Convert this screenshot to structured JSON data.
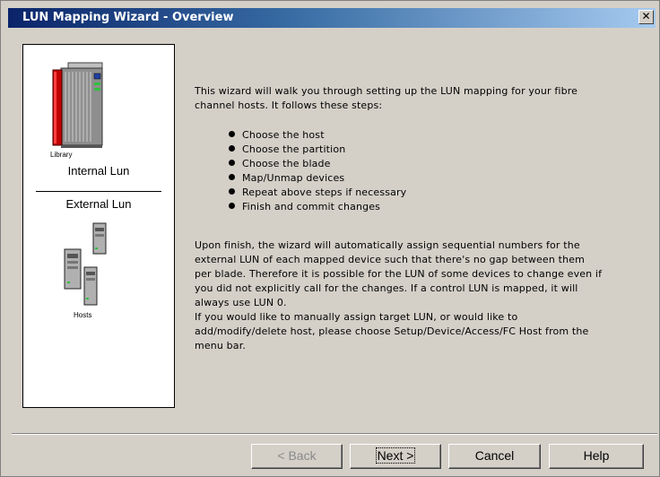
{
  "window": {
    "title": "LUN Mapping Wizard - Overview",
    "close_glyph": "✕"
  },
  "sidebar": {
    "library_label": "Library",
    "internal_lun": "Internal Lun",
    "external_lun": "External Lun",
    "hosts_label": "Hosts"
  },
  "content": {
    "intro_lines": [
      "This wizard will walk you through setting up the LUN mapping for your fibre",
      "channel hosts. It follows these steps:"
    ],
    "steps": [
      "Choose the host",
      "Choose the partition",
      "Choose the blade",
      "Map/Unmap devices",
      "Repeat above steps if necessary",
      "Finish and commit changes"
    ],
    "body_lines": [
      "Upon finish, the wizard will automatically assign sequential numbers for the",
      "external LUN of each mapped device such that there's no gap between them",
      "per blade. Therefore it is possible for the LUN of some devices to change even if",
      "you did not explicitly call for the changes. If a control LUN is mapped, it will",
      "always use LUN 0.",
      "If you would like to manually assign target LUN, or would like to",
      "add/modify/delete host, please choose Setup/Device/Access/FC Host from the",
      "menu bar."
    ]
  },
  "buttons": {
    "back": "< Back",
    "next": "Next >",
    "cancel": "Cancel",
    "help": "Help"
  },
  "colors": {
    "title_gradient_start": "#0a246a",
    "title_gradient_end": "#a6caf0",
    "dialog_face": "#d4d0c8",
    "library_accent": "#c00000"
  },
  "icons": {
    "library": "library-tower-icon",
    "hosts": "host-servers-icon"
  }
}
